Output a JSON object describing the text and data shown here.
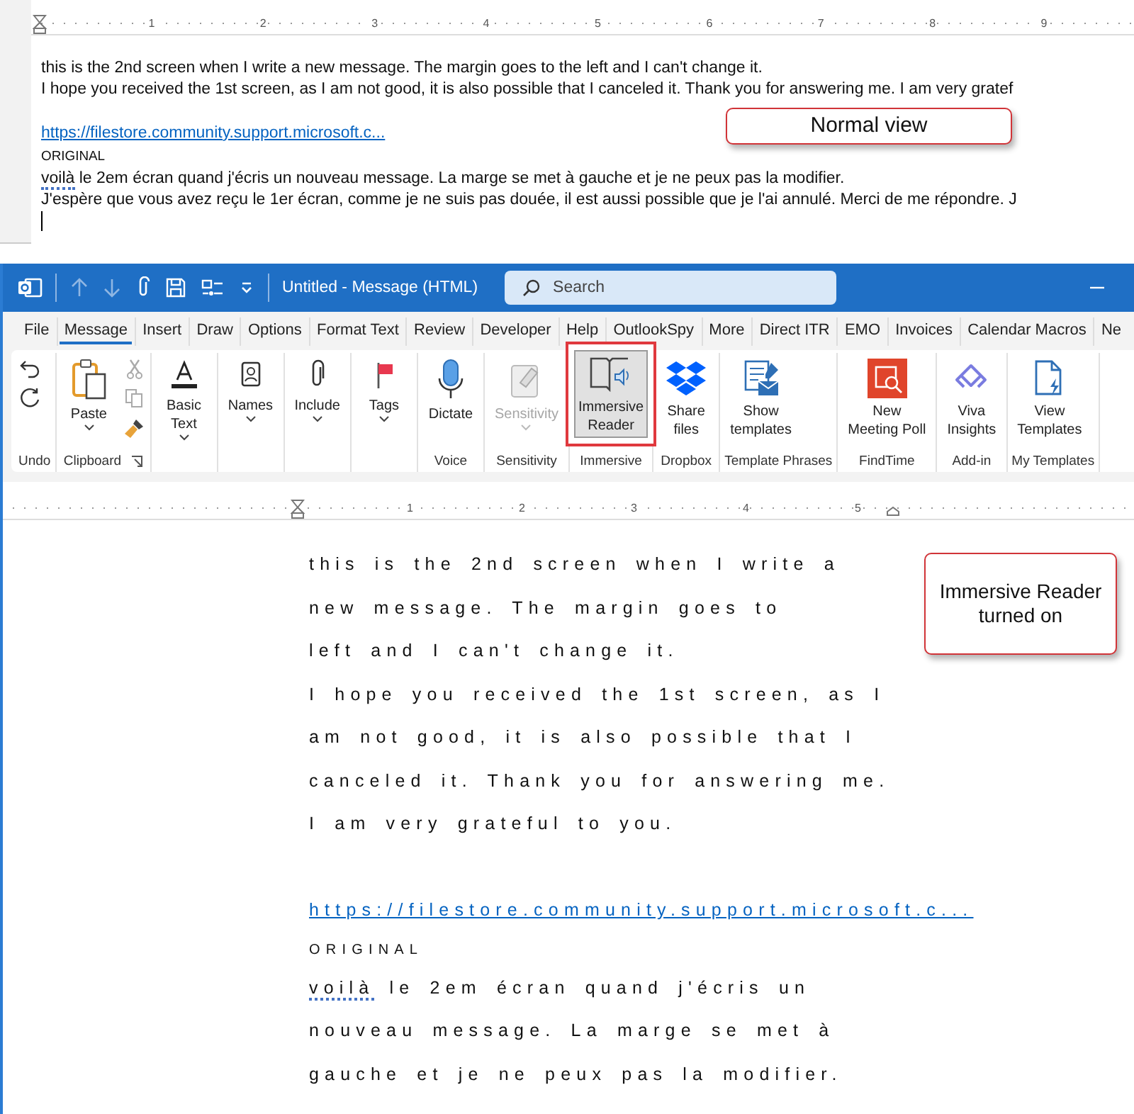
{
  "normal_view": {
    "ruler": {
      "ticks": [
        "1",
        "2",
        "3",
        "4",
        "5",
        "6",
        "7",
        "8",
        "9"
      ]
    },
    "lines": [
      {
        "kind": "text",
        "segments": [
          {
            "text": "this is the 2nd screen when I write a new message. The margin goes to the left and I can't change it.",
            "misspelled": false
          }
        ]
      },
      {
        "kind": "text",
        "segments": [
          {
            "text": "I hope you received the 1st screen, as I am not good, it is also possible that I canceled it. Thank you for answering me. I am very gratef",
            "misspelled": false
          }
        ]
      },
      {
        "kind": "blank"
      },
      {
        "kind": "link",
        "segments": [
          {
            "text": "https://filestore.community.support.microsoft.c...",
            "misspelled": false
          }
        ]
      },
      {
        "kind": "small",
        "segments": [
          {
            "text": "ORIGINAL",
            "misspelled": false
          }
        ]
      },
      {
        "kind": "text",
        "segments": [
          {
            "text": "voilà",
            "misspelled": true
          },
          {
            "text": " le 2em écran quand j'écris un nouveau message. La marge se met à gauche et je ne peux pas la modifier.",
            "misspelled": false
          }
        ]
      },
      {
        "kind": "text",
        "segments": [
          {
            "text": "J'espère que vous avez reçu le 1er écran, comme je ne suis pas douée, il est aussi possible que je l'ai annulé. Merci de me répondre. J",
            "misspelled": false
          }
        ]
      },
      {
        "kind": "cursor"
      }
    ],
    "callout": "Normal view"
  },
  "window": {
    "title": "Untitled  -  Message (HTML)",
    "search": {
      "placeholder": "Search"
    }
  },
  "tabs": [
    {
      "label": "File",
      "selected": false
    },
    {
      "label": "Message",
      "selected": true
    },
    {
      "label": "Insert",
      "selected": false
    },
    {
      "label": "Draw",
      "selected": false
    },
    {
      "label": "Options",
      "selected": false
    },
    {
      "label": "Format Text",
      "selected": false
    },
    {
      "label": "Review",
      "selected": false
    },
    {
      "label": "Developer",
      "selected": false
    },
    {
      "label": "Help",
      "selected": false
    },
    {
      "label": "OutlookSpy",
      "selected": false
    },
    {
      "label": "More",
      "selected": false
    },
    {
      "label": "Direct ITR",
      "selected": false
    },
    {
      "label": "EMO",
      "selected": false
    },
    {
      "label": "Invoices",
      "selected": false
    },
    {
      "label": "Calendar Macros",
      "selected": false
    },
    {
      "label": "Ne",
      "selected": false
    }
  ],
  "ribbon": {
    "groups": [
      {
        "label": "Undo"
      },
      {
        "label": "Clipboard",
        "buttons": [
          {
            "label": "Paste",
            "dropdown": true,
            "disabled": false,
            "selected": false,
            "highlighted": false
          }
        ]
      },
      {
        "buttons": [
          {
            "label": "Basic\nText",
            "dropdown": true,
            "disabled": false,
            "selected": false,
            "highlighted": false
          }
        ]
      },
      {
        "buttons": [
          {
            "label": "Names",
            "dropdown": true,
            "disabled": false,
            "selected": false,
            "highlighted": false
          }
        ]
      },
      {
        "buttons": [
          {
            "label": "Include",
            "dropdown": true,
            "disabled": false,
            "selected": false,
            "highlighted": false
          }
        ]
      },
      {
        "buttons": [
          {
            "label": "Tags",
            "dropdown": true,
            "disabled": false,
            "selected": false,
            "highlighted": false
          }
        ]
      },
      {
        "label": "Voice",
        "buttons": [
          {
            "label": "Dictate",
            "dropdown": false,
            "disabled": false,
            "selected": false,
            "highlighted": false
          }
        ]
      },
      {
        "label": "Sensitivity",
        "buttons": [
          {
            "label": "Sensitivity",
            "dropdown": true,
            "disabled": true,
            "selected": false,
            "highlighted": false
          }
        ]
      },
      {
        "label": "Immersive",
        "buttons": [
          {
            "label": "Immersive\nReader",
            "dropdown": false,
            "disabled": false,
            "selected": true,
            "highlighted": true
          }
        ]
      },
      {
        "label": "Dropbox",
        "buttons": [
          {
            "label": "Share\nfiles",
            "dropdown": false,
            "disabled": false,
            "selected": false,
            "highlighted": false
          }
        ]
      },
      {
        "label": "Template Phrases",
        "buttons": [
          {
            "label": "Show\ntemplates",
            "dropdown": false,
            "disabled": false,
            "selected": false,
            "highlighted": false
          }
        ]
      },
      {
        "label": "FindTime",
        "buttons": [
          {
            "label": "New\nMeeting Poll",
            "dropdown": false,
            "disabled": false,
            "selected": false,
            "highlighted": false
          }
        ]
      },
      {
        "label": "Add-in",
        "buttons": [
          {
            "label": "Viva\nInsights",
            "dropdown": false,
            "disabled": false,
            "selected": false,
            "highlighted": false
          }
        ]
      },
      {
        "label": "My Templates",
        "buttons": [
          {
            "label": "View\nTemplates",
            "dropdown": false,
            "disabled": false,
            "selected": false,
            "highlighted": false
          }
        ]
      }
    ]
  },
  "immersive_view": {
    "ruler": {
      "ticks": [
        "1",
        "2",
        "3",
        "4",
        "5"
      ]
    },
    "lines": [
      {
        "kind": "text",
        "segments": [
          {
            "text": "this is the 2nd screen when I write a",
            "misspelled": false
          }
        ]
      },
      {
        "kind": "text",
        "segments": [
          {
            "text": "new message. The margin goes to",
            "misspelled": false
          }
        ]
      },
      {
        "kind": "text",
        "segments": [
          {
            "text": "left and I can't change it.",
            "misspelled": false
          }
        ]
      },
      {
        "kind": "text",
        "segments": [
          {
            "text": "I hope you received the 1st screen, as I",
            "misspelled": false
          }
        ]
      },
      {
        "kind": "text",
        "segments": [
          {
            "text": "am not good, it is also possible that I",
            "misspelled": false
          }
        ]
      },
      {
        "kind": "text",
        "segments": [
          {
            "text": "canceled it. Thank you for answering me.",
            "misspelled": false
          }
        ]
      },
      {
        "kind": "text",
        "segments": [
          {
            "text": "I am very grateful to you.",
            "misspelled": false
          }
        ]
      },
      {
        "kind": "blank"
      },
      {
        "kind": "link",
        "segments": [
          {
            "text": "https://filestore.community.support.microsoft.c...",
            "misspelled": false
          }
        ]
      },
      {
        "kind": "small",
        "segments": [
          {
            "text": "ORIGINAL",
            "misspelled": false
          }
        ]
      },
      {
        "kind": "text",
        "segments": [
          {
            "text": "voilà",
            "misspelled": true
          },
          {
            "text": " le 2em écran quand j'écris un",
            "misspelled": false
          }
        ]
      },
      {
        "kind": "text",
        "segments": [
          {
            "text": "nouveau message. La marge se met à",
            "misspelled": false
          }
        ]
      },
      {
        "kind": "text",
        "segments": [
          {
            "text": "gauche et je ne peux pas la modifier.",
            "misspelled": false
          }
        ]
      }
    ],
    "callout": "Immersive Reader turned on"
  }
}
